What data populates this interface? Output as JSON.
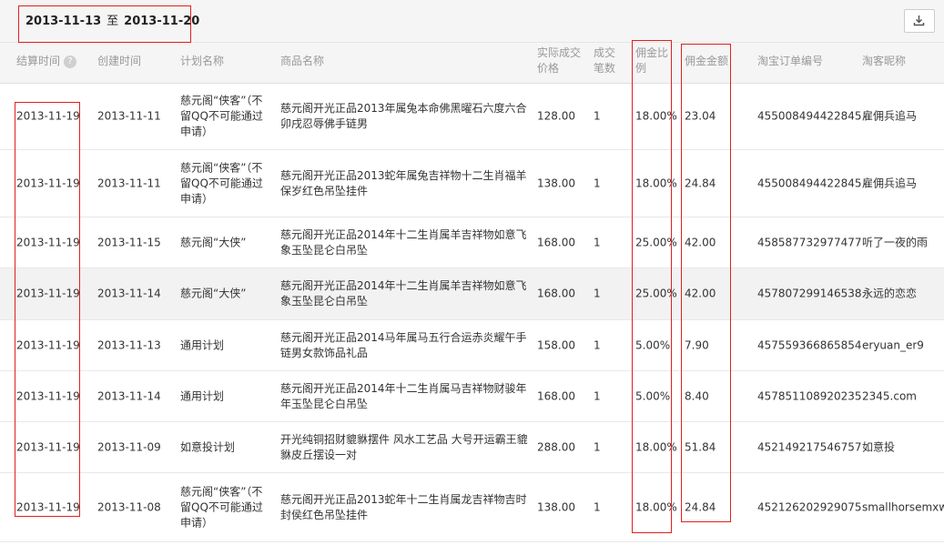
{
  "date_range": {
    "start": "2013-11-13",
    "separator": "至",
    "end": "2013-11-20"
  },
  "download_icon": "download-icon",
  "headers": {
    "settle_time": "结算时间",
    "create_time": "创建时间",
    "plan_name": "计划名称",
    "goods_name": "商品名称",
    "price_l1": "实际成交",
    "price_l2": "价格",
    "count_l1": "成交",
    "count_l2": "笔数",
    "rate_l1": "佣金比",
    "rate_l2": "例",
    "amount": "佣金金额",
    "order_no": "淘宝订单编号",
    "nickname": "淘客昵称"
  },
  "rows": [
    {
      "settle": "2013-11-19",
      "create": "2013-11-11",
      "plan": "慈元阁“侠客”（不留QQ不可能通过申请）",
      "goods": "慈元阁开光正品2013年属兔本命佛黑曜石六度六合卯戌忍辱佛手链男",
      "price": "128.00",
      "count": "1",
      "rate": "18.00%",
      "amount": "23.04",
      "order": "455008494422845",
      "nick": "雇佣兵追马"
    },
    {
      "settle": "2013-11-19",
      "create": "2013-11-11",
      "plan": "慈元阁“侠客”（不留QQ不可能通过申请）",
      "goods": "慈元阁开光正品2013蛇年属兔吉祥物十二生肖福羊保岁红色吊坠挂件",
      "price": "138.00",
      "count": "1",
      "rate": "18.00%",
      "amount": "24.84",
      "order": "455008494422845",
      "nick": "雇佣兵追马"
    },
    {
      "settle": "2013-11-19",
      "create": "2013-11-15",
      "plan": "慈元阁“大侠”",
      "goods": "慈元阁开光正品2014年十二生肖属羊吉祥物如意飞象玉坠昆仑白吊坠",
      "price": "168.00",
      "count": "1",
      "rate": "25.00%",
      "amount": "42.00",
      "order": "458587732977477",
      "nick": "听了一夜的雨"
    },
    {
      "settle": "2013-11-19",
      "create": "2013-11-14",
      "plan": "慈元阁“大侠”",
      "goods": "慈元阁开光正品2014年十二生肖属羊吉祥物如意飞象玉坠昆仑白吊坠",
      "price": "168.00",
      "count": "1",
      "rate": "25.00%",
      "amount": "42.00",
      "order": "457807299146538",
      "nick": "永远的恋恋"
    },
    {
      "settle": "2013-11-19",
      "create": "2013-11-13",
      "plan": "通用计划",
      "goods": "慈元阁开光正品2014马年属马五行合运赤炎耀午手链男女款饰品礼品",
      "price": "158.00",
      "count": "1",
      "rate": "5.00%",
      "amount": "7.90",
      "order": "457559366865854",
      "nick": "eryuan_er9"
    },
    {
      "settle": "2013-11-19",
      "create": "2013-11-14",
      "plan": "通用计划",
      "goods": "慈元阁开光正品2014年十二生肖属马吉祥物财骏年年玉坠昆仑白吊坠",
      "price": "168.00",
      "count": "1",
      "rate": "5.00%",
      "amount": "8.40",
      "order": "457851108920235",
      "nick": "2345.com"
    },
    {
      "settle": "2013-11-19",
      "create": "2013-11-09",
      "plan": "如意投计划",
      "goods": "开光纯铜招财貔貅摆件 风水工艺品 大号开运霸王貔貅皮丘摆设一对",
      "price": "288.00",
      "count": "1",
      "rate": "18.00%",
      "amount": "51.84",
      "order": "452149217546757",
      "nick": "如意投"
    },
    {
      "settle": "2013-11-19",
      "create": "2013-11-08",
      "plan": "慈元阁“侠客”（不留QQ不可能通过申请）",
      "goods": "慈元阁开光正品2013蛇年十二生肖属龙吉祥物吉时封侯红色吊坠挂件",
      "price": "138.00",
      "count": "1",
      "rate": "18.00%",
      "amount": "24.84",
      "order": "452126202929075",
      "nick": "smallhorsemxw"
    }
  ]
}
